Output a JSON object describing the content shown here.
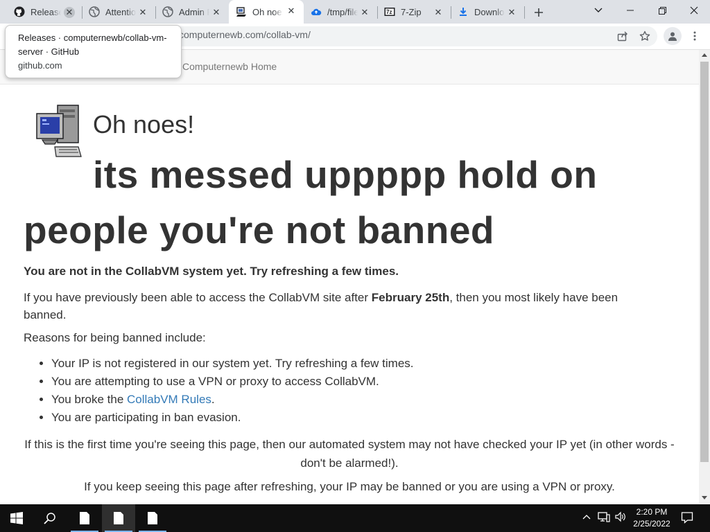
{
  "tabs": [
    {
      "label": "Releases · computernewb/collab-vm-server",
      "icon": "github-icon"
    },
    {
      "label": "Attention",
      "icon": "globe-icon"
    },
    {
      "label": "Admin Panel",
      "icon": "globe-icon"
    },
    {
      "label": "Oh noes!",
      "icon": "collabvm-icon"
    },
    {
      "label": "/tmp/files",
      "icon": "cloud-icon"
    },
    {
      "label": "7-Zip",
      "icon": "7zip-icon"
    },
    {
      "label": "Downloads",
      "icon": "download-icon"
    }
  ],
  "tooltip": {
    "title": "Releases · computernewb/collab-vm-server · GitHub",
    "host": "github.com"
  },
  "address_bar": {
    "url": "computernewb.com/collab-vm/"
  },
  "navbar": {
    "brand": "Computernewb Home"
  },
  "page": {
    "heading_small": "Oh noes!",
    "heading_big_line1": "its messed uppppp hold on",
    "heading_big_line2": "people you're not banned",
    "notice": "You are not in the CollabVM system yet. Try refreshing a few times.",
    "p2_before": "If you have previously been able to access the CollabVM site after ",
    "p2_bold": "February 25th",
    "p2_after": ", then you most likely have been banned.",
    "reasons_intro": "Reasons for being banned include:",
    "reasons": [
      "Your IP is not registered in our system yet. Try refreshing a few times.",
      "You are attempting to use a VPN or proxy to access CollabVM."
    ],
    "reason3_before": "You broke the ",
    "reason3_link": "CollabVM Rules",
    "reason3_after": ".",
    "reason4": "You are participating in ban evasion.",
    "first_time": "If this is the first time you're seeing this page, then our automated system may not have checked your IP yet (in other words - don't be alarmed!).",
    "keep_seeing": "If you keep seeing this page after refreshing, your IP may be banned or you are using a VPN or proxy."
  },
  "taskbar": {
    "time": "2:20 PM",
    "date": "2/25/2022"
  },
  "colors": {
    "link": "#337ab7",
    "text": "#333333",
    "taskbar": "#101010"
  }
}
